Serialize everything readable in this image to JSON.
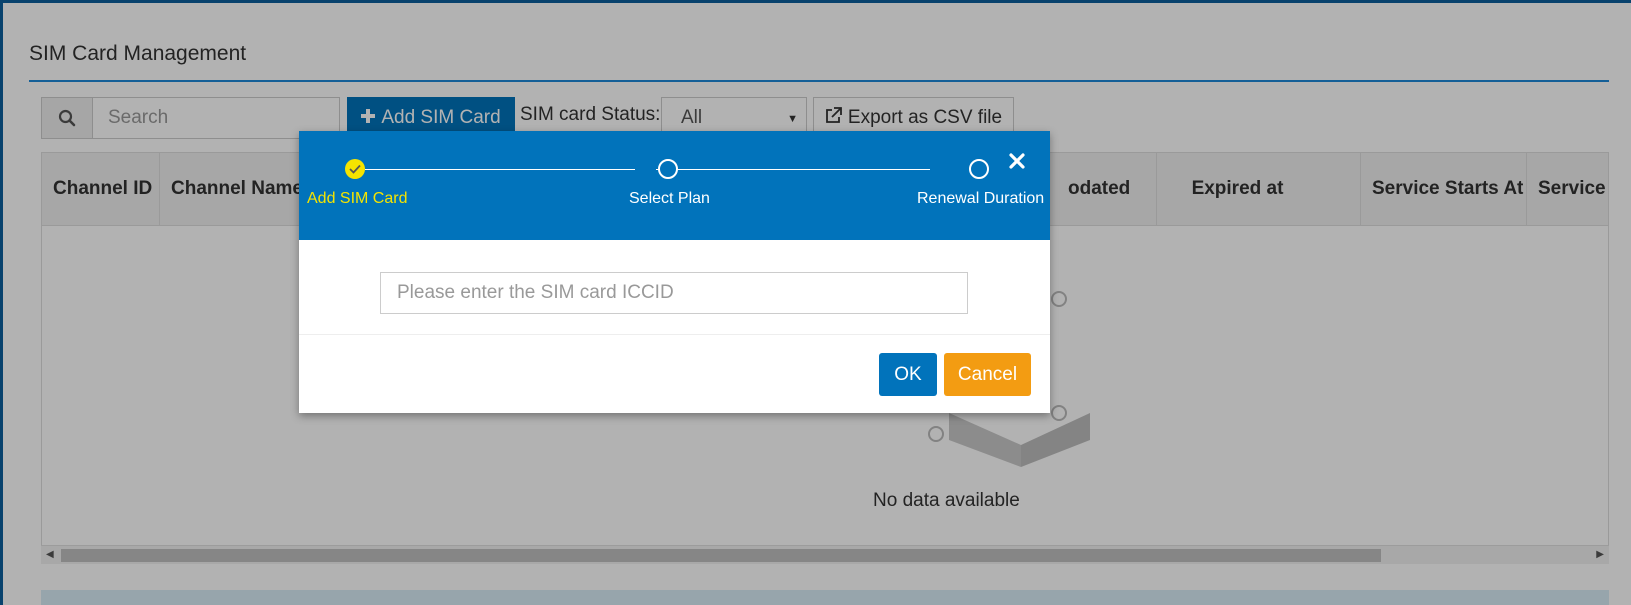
{
  "page": {
    "title": "SIM Card Management"
  },
  "toolbar": {
    "search_placeholder": "Search",
    "add_label": "Add SIM Card",
    "status_label": "SIM card Status:",
    "status_value": "All",
    "export_label": "Export as CSV file"
  },
  "table": {
    "columns": [
      "Channel ID",
      "Channel Name",
      "",
      "",
      "",
      "",
      "Updated",
      "Expired at",
      "Service Starts At",
      "Service"
    ],
    "header_visible": {
      "col0": "Channel ID",
      "col1": "Channel Name",
      "col_updated": "odated",
      "col_expired": "Expired at",
      "col_service_start": "Service Starts At",
      "col_service": "Service"
    },
    "empty_text": "No data available"
  },
  "modal": {
    "steps": [
      {
        "label": "Add SIM Card",
        "state": "done"
      },
      {
        "label": "Select Plan",
        "state": "todo"
      },
      {
        "label": "Renewal Duration",
        "state": "todo"
      }
    ],
    "iccid_placeholder": "Please enter the SIM card ICCID",
    "ok_label": "OK",
    "cancel_label": "Cancel"
  },
  "colors": {
    "primary": "#0173bb",
    "warning": "#f39c12",
    "step_active": "#f5e400"
  },
  "icons": [
    "search-icon",
    "plus-icon",
    "caret-down-icon",
    "external-link-icon",
    "check-icon",
    "close-icon",
    "empty-box-icon"
  ]
}
